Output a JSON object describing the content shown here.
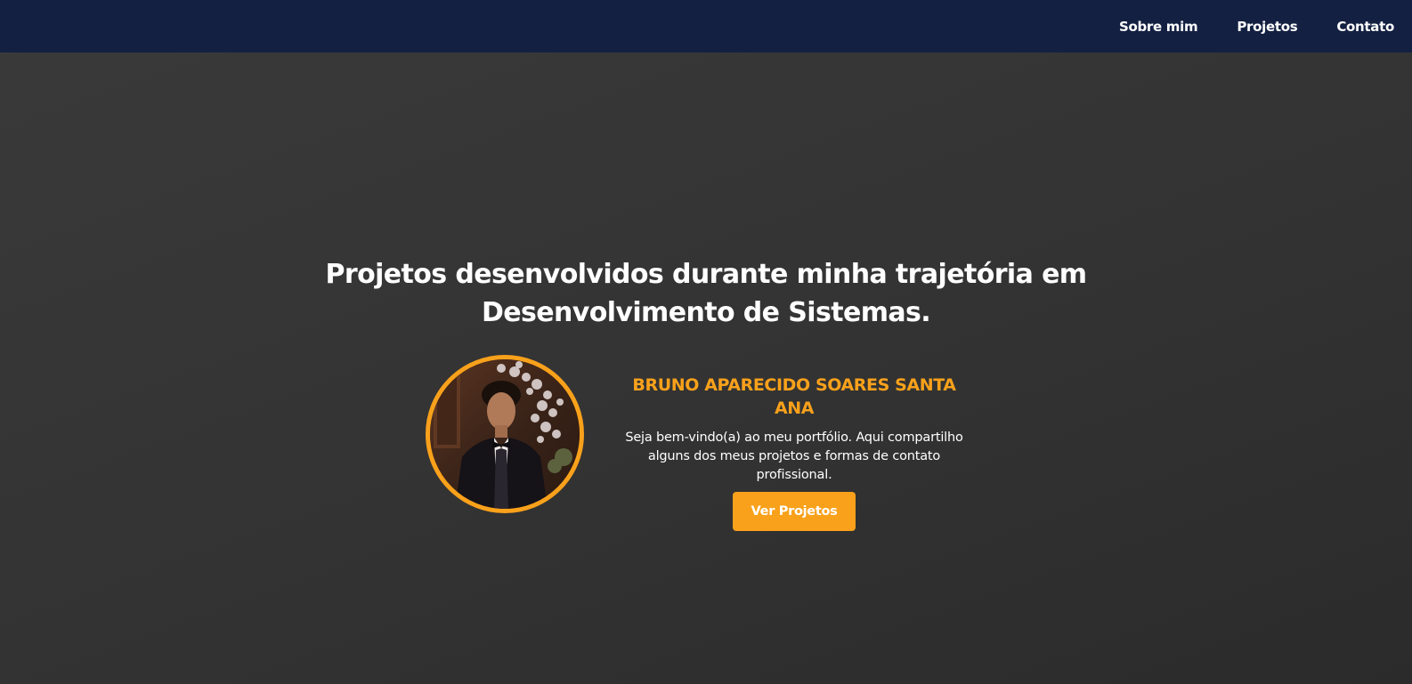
{
  "nav": {
    "items": [
      {
        "label": "Sobre mim"
      },
      {
        "label": "Projetos"
      },
      {
        "label": "Contato"
      }
    ]
  },
  "hero": {
    "title_line1": "Projetos desenvolvidos durante minha trajetória em",
    "title_line2": "Desenvolvimento de Sistemas."
  },
  "profile": {
    "name": "BRUNO APARECIDO SOARES SANTA ANA",
    "description": "Seja bem-vindo(a) ao meu portfólio. Aqui compartilho alguns dos meus projetos e formas de contato profissional.",
    "button_label": "Ver Projetos",
    "photo_icon": "person-photo"
  },
  "colors": {
    "nav_bg": "#132042",
    "accent": "#f9a11b",
    "background": "#333333",
    "text": "#ffffff"
  }
}
